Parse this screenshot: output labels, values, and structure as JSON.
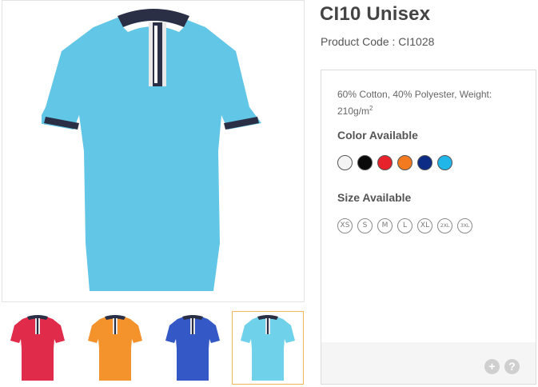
{
  "product": {
    "title": "CI10 Unisex",
    "code": "Product Code : CI1028",
    "material": "60% Cotton, 40% Polyester, Weight: 210g/m",
    "material_sup": "2"
  },
  "colors": {
    "label": "Color Available",
    "swatches": [
      {
        "name": "white",
        "hex": "#f4f4f4"
      },
      {
        "name": "black",
        "hex": "#0a0a0a"
      },
      {
        "name": "red",
        "hex": "#e8222a"
      },
      {
        "name": "orange",
        "hex": "#f47a20"
      },
      {
        "name": "navy",
        "hex": "#0c2c86"
      },
      {
        "name": "sky-blue",
        "hex": "#21b6e8"
      }
    ]
  },
  "sizes": {
    "label": "Size Available",
    "items": [
      "XS",
      "S",
      "M",
      "L",
      "XL",
      "2XL",
      "3XL"
    ]
  },
  "thumbnails": [
    {
      "name": "red",
      "body": "#e02b4a"
    },
    {
      "name": "orange",
      "body": "#f4922c"
    },
    {
      "name": "royal-blue",
      "body": "#3458c6"
    },
    {
      "name": "sky-blue",
      "body": "#6fd1ea",
      "active": true
    }
  ],
  "main_shirt_color": "#62c6e6",
  "footer": {
    "plus": "+",
    "help": "?"
  }
}
